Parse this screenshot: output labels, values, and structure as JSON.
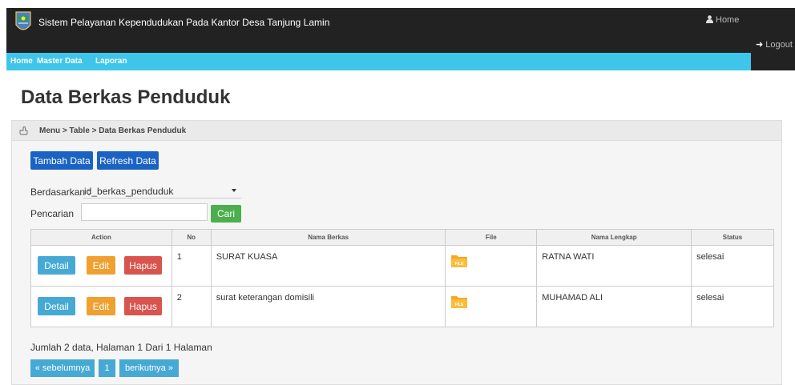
{
  "header": {
    "app_title": "Sistem Pelayanan Kependudukan Pada Kantor Desa Tanjung Lamin",
    "home_link": "Home",
    "logout_link": "Logout"
  },
  "nav": {
    "items": [
      "Home",
      "Master Data",
      "Laporan"
    ]
  },
  "page": {
    "title": "Data Berkas Penduduk",
    "breadcrumb": "Menu > Table > Data Berkas Penduduk"
  },
  "toolbar": {
    "add_label": "Tambah Data",
    "refresh_label": "Refresh Data"
  },
  "filter": {
    "by_label": "Berdasarkan :",
    "by_value": "id_berkas_penduduk",
    "search_label": "Pencarian   :",
    "search_value": "",
    "search_button": "Cari"
  },
  "table": {
    "columns": [
      "Action",
      "No",
      "Nama Berkas",
      "File",
      "Nama Lengkap",
      "Status"
    ],
    "action_labels": {
      "detail": "Detail",
      "edit": "Edit",
      "delete": "Hapus"
    },
    "file_icon_text": "FILE",
    "rows": [
      {
        "no": "1",
        "nama_berkas": "SURAT KUASA",
        "nama_lengkap": "RATNA WATI",
        "status": "selesai"
      },
      {
        "no": "2",
        "nama_berkas": "surat keterangan domisili",
        "nama_lengkap": "MUHAMAD ALI",
        "status": "selesai"
      }
    ]
  },
  "footer": {
    "summary": "Jumlah 2 data, Halaman 1 Dari 1 Halaman",
    "prev": "« sebelumnya",
    "page": "1",
    "next": "berikutnya »"
  },
  "colors": {
    "topbar": "#222222",
    "navbar": "#3ec6ea",
    "primary": "#1a63c4",
    "info": "#45a9d4",
    "warning": "#f0a030",
    "danger": "#d9534f",
    "success": "#4cae4c"
  }
}
